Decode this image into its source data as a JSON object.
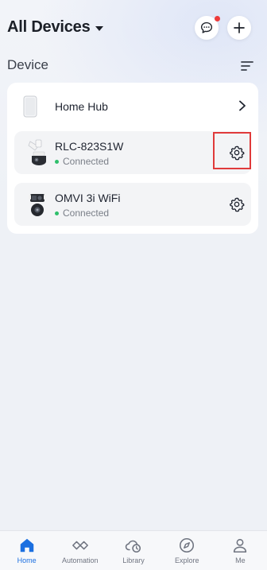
{
  "header": {
    "title": "All Devices",
    "message_icon": "chat-bubble-icon",
    "add_icon": "plus-icon",
    "has_notification": true
  },
  "section": {
    "title": "Device",
    "sort_icon": "sort-lines-icon"
  },
  "hub": {
    "label": "Home Hub",
    "icon": "hub-device-icon"
  },
  "devices": [
    {
      "name": "RLC-823S1W",
      "status": "Connected",
      "icon": "bullet-ptz-camera-icon"
    },
    {
      "name": "OMVI 3i WiFi",
      "status": "Connected",
      "icon": "dual-lens-camera-icon"
    }
  ],
  "tabs": [
    {
      "label": "Home",
      "icon": "home-icon",
      "active": true
    },
    {
      "label": "Automation",
      "icon": "automation-icon",
      "active": false
    },
    {
      "label": "Library",
      "icon": "cloud-clock-icon",
      "active": false
    },
    {
      "label": "Explore",
      "icon": "compass-icon",
      "active": false
    },
    {
      "label": "Me",
      "icon": "person-icon",
      "active": false
    }
  ],
  "colors": {
    "accent": "#1b6fe0",
    "connected": "#2fbf6b",
    "notification": "#ee3b3b",
    "highlight": "#e03a3a"
  }
}
